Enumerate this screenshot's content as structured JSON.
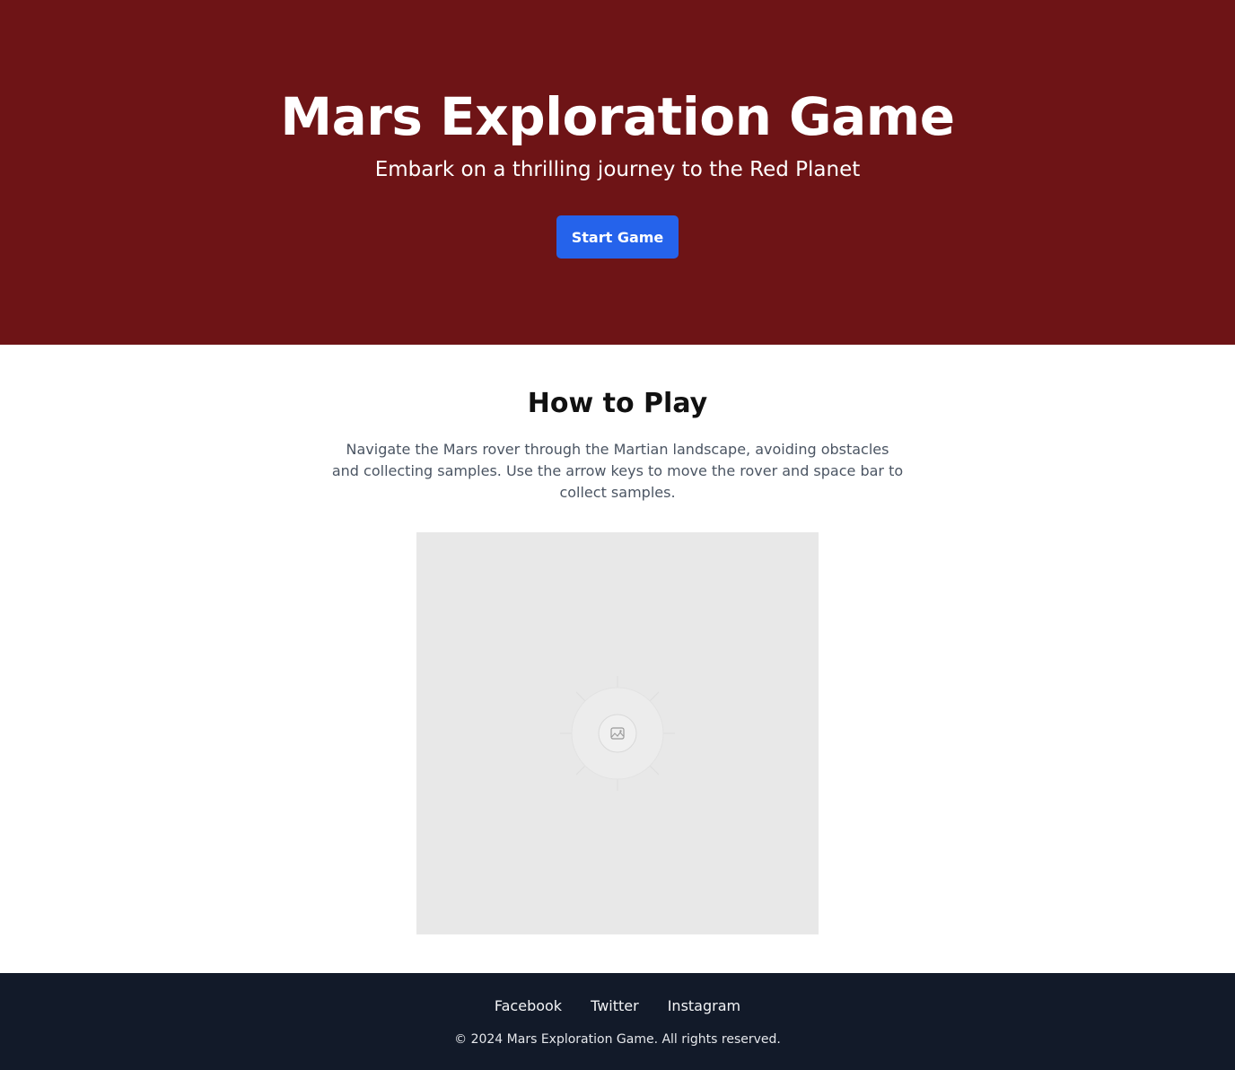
{
  "hero": {
    "title": "Mars Exploration Game",
    "subtitle": "Embark on a thrilling journey to the Red Planet",
    "button_label": "Start Game"
  },
  "how_to_play": {
    "title": "How to Play",
    "description": "Navigate the Mars rover through the Martian landscape, avoiding obstacles and collecting samples. Use the arrow keys to move the rover and space bar to collect samples.",
    "image_icon": "image-placeholder-icon"
  },
  "footer": {
    "links": [
      {
        "label": "Facebook"
      },
      {
        "label": "Twitter"
      },
      {
        "label": "Instagram"
      }
    ],
    "copyright": "© 2024 Mars Exploration Game. All rights reserved."
  },
  "colors": {
    "hero_bg": "#6e1416",
    "button_bg": "#2563eb",
    "footer_bg": "#121a29",
    "placeholder_bg": "#e8e8e8"
  }
}
